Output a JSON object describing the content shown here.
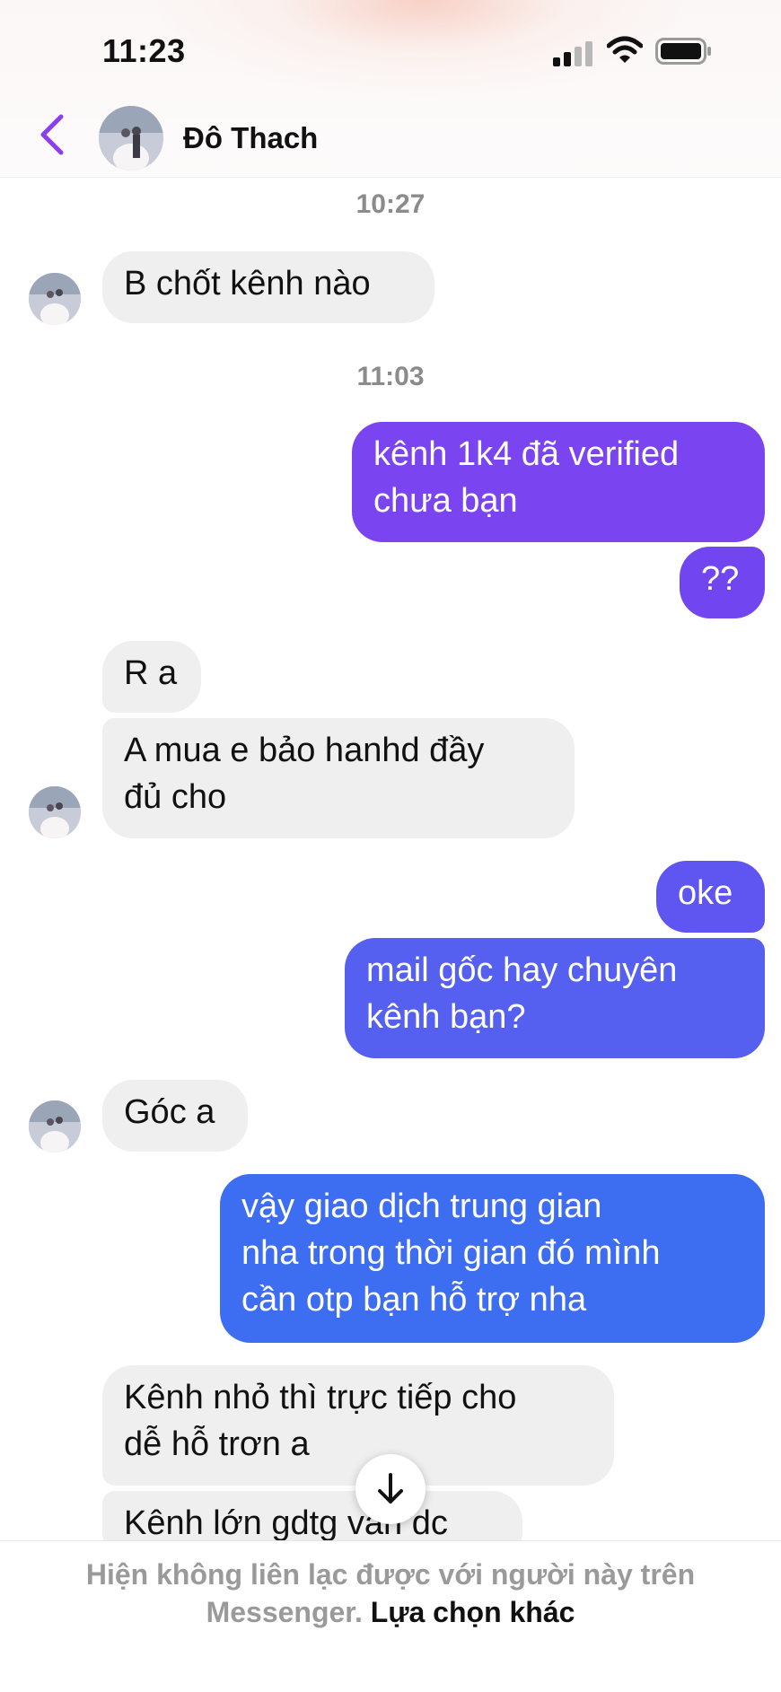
{
  "status_bar": {
    "time": "11:23"
  },
  "header": {
    "contact_name": "Đô Thach"
  },
  "timestamps": [
    "10:27",
    "11:03"
  ],
  "messages": [
    {
      "side": "in",
      "text": "B chốt kênh nào"
    },
    {
      "side": "out",
      "lines": [
        "kênh 1k4 đã verified",
        "chưa bạn"
      ]
    },
    {
      "side": "out",
      "text": "??"
    },
    {
      "side": "in",
      "text": "R a"
    },
    {
      "side": "in",
      "lines": [
        "A mua e bảo hanhd đầy",
        "đủ cho"
      ]
    },
    {
      "side": "out",
      "text": "oke"
    },
    {
      "side": "out",
      "lines": [
        "mail gốc hay chuyên",
        "kênh bạn?"
      ]
    },
    {
      "side": "in",
      "text": "Góc a"
    },
    {
      "side": "out",
      "lines": [
        "vậy giao dịch trung gian",
        "nha trong thời gian đó mình",
        "cần otp bạn hỗ trợ nha"
      ]
    },
    {
      "side": "in",
      "lines": [
        "Kênh nhỏ thì trực tiếp cho",
        "dễ hỗ trơn a"
      ]
    },
    {
      "side": "in",
      "text": "Kênh lớn gdtg vẫn dc"
    }
  ],
  "footer": {
    "notice_line1": "Hiện không liên lạc được với người này trên",
    "notice_line2": "Messenger.",
    "link": "Lựa chọn khác"
  },
  "colors": {
    "accent_back": "#8b3df0",
    "outgoing_top": "#7a45f0",
    "outgoing_bottom": "#3d6ef2",
    "incoming": "#efefef"
  },
  "icons": [
    "back-chevron-icon",
    "signal-icon",
    "wifi-icon",
    "battery-icon",
    "arrow-down-icon"
  ]
}
